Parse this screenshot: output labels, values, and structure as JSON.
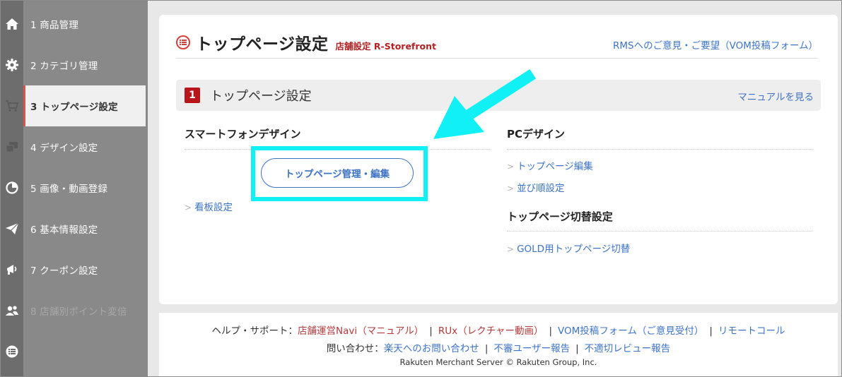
{
  "sidebar": {
    "items": [
      {
        "label": "1  商品管理",
        "icon": "home-icon"
      },
      {
        "label": "2  カテゴリ管理",
        "icon": "gear-icon"
      },
      {
        "label": "3  トップページ設定",
        "icon": "cart-icon",
        "active": true
      },
      {
        "label": "4  デザイン設定",
        "icon": "design-icon"
      },
      {
        "label": "5  画像・動画登録",
        "icon": "pie-chart-icon"
      },
      {
        "label": "6  基本情報設定",
        "icon": "paper-plane-icon"
      },
      {
        "label": "7  クーポン設定",
        "icon": "megaphone-icon"
      },
      {
        "label": "8  店舗別ポイント変倍",
        "icon": "users-icon",
        "disabled": true
      }
    ]
  },
  "header": {
    "title": "トップページ設定",
    "subtitle": "店舗設定 R-Storefront",
    "feedback_link": "RMSへのご意見・ご要望（VOM投稿フォーム）"
  },
  "section": {
    "number": "1",
    "title": "トップページ設定",
    "manual_link": "マニュアルを見る"
  },
  "smartphone": {
    "heading": "スマートフォンデザイン",
    "button_label": "トップページ管理・編集",
    "link_signboard": "看板設定"
  },
  "pc": {
    "heading": "PCデザイン",
    "link_edit": "トップページ編集",
    "link_order": "並び順設定"
  },
  "switch": {
    "heading": "トップページ切替設定",
    "link_gold": "GOLD用トップページ切替"
  },
  "footer": {
    "help_label": "ヘルプ・サポート：",
    "help_links": [
      "店舗運営Navi（マニュアル）",
      "RUx（レクチャー動画）",
      "VOM投稿フォーム（ご意見受付）",
      "リモートコール"
    ],
    "contact_label": "問い合わせ：",
    "contact_links": [
      "楽天へのお問い合わせ",
      "不審ユーザー報告",
      "不適切レビュー報告"
    ],
    "copyright": "Rakuten Merchant Server © Rakuten Group, Inc."
  },
  "colors": {
    "accent_red": "#b8161b",
    "link_blue": "#3d73c5",
    "highlight_cyan": "#11f0f5",
    "sidebar_gray": "#898989"
  }
}
